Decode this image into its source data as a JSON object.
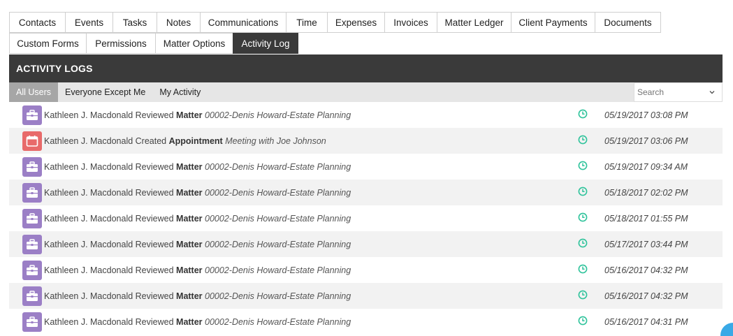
{
  "tabs_row1": [
    {
      "label": "Contacts",
      "name": "tab-contacts"
    },
    {
      "label": "Events",
      "name": "tab-events"
    },
    {
      "label": "Tasks",
      "name": "tab-tasks"
    },
    {
      "label": "Notes",
      "name": "tab-notes"
    },
    {
      "label": "Communications",
      "name": "tab-communications"
    },
    {
      "label": "Time",
      "name": "tab-time"
    },
    {
      "label": "Expenses",
      "name": "tab-expenses"
    },
    {
      "label": "Invoices",
      "name": "tab-invoices"
    },
    {
      "label": "Matter Ledger",
      "name": "tab-matter-ledger"
    },
    {
      "label": "Client Payments",
      "name": "tab-client-payments"
    },
    {
      "label": "Documents",
      "name": "tab-documents"
    }
  ],
  "tabs_row2": [
    {
      "label": "Custom Forms",
      "name": "tab-custom-forms"
    },
    {
      "label": "Permissions",
      "name": "tab-permissions"
    },
    {
      "label": "Matter Options",
      "name": "tab-matter-options"
    },
    {
      "label": "Activity Log",
      "name": "tab-activity-log",
      "active": true
    }
  ],
  "panel": {
    "title": "ACTIVITY LOGS"
  },
  "filters": [
    {
      "label": "All Users",
      "active": true
    },
    {
      "label": "Everyone Except Me"
    },
    {
      "label": "My Activity"
    }
  ],
  "search": {
    "placeholder": "Search"
  },
  "colors": {
    "header": "#3a3a3a",
    "matter_icon": "#9b7fc6",
    "appointment_icon": "#e86a6a",
    "clock": "#2fc39b"
  },
  "logs": [
    {
      "user": "Kathleen J. Macdonald",
      "action": "Reviewed",
      "type": "Matter",
      "detail": "00002-Denis Howard-Estate Planning",
      "time": "05/19/2017 03:08 PM",
      "icon": "briefcase-icon"
    },
    {
      "user": "Kathleen J. Macdonald",
      "action": "Created",
      "type": "Appointment",
      "detail": "Meeting with Joe Johnson",
      "time": "05/19/2017 03:06 PM",
      "icon": "calendar-icon"
    },
    {
      "user": "Kathleen J. Macdonald",
      "action": "Reviewed",
      "type": "Matter",
      "detail": "00002-Denis Howard-Estate Planning",
      "time": "05/19/2017 09:34 AM",
      "icon": "briefcase-icon"
    },
    {
      "user": "Kathleen J. Macdonald",
      "action": "Reviewed",
      "type": "Matter",
      "detail": "00002-Denis Howard-Estate Planning",
      "time": "05/18/2017 02:02 PM",
      "icon": "briefcase-icon"
    },
    {
      "user": "Kathleen J. Macdonald",
      "action": "Reviewed",
      "type": "Matter",
      "detail": "00002-Denis Howard-Estate Planning",
      "time": "05/18/2017 01:55 PM",
      "icon": "briefcase-icon"
    },
    {
      "user": "Kathleen J. Macdonald",
      "action": "Reviewed",
      "type": "Matter",
      "detail": "00002-Denis Howard-Estate Planning",
      "time": "05/17/2017 03:44 PM",
      "icon": "briefcase-icon"
    },
    {
      "user": "Kathleen J. Macdonald",
      "action": "Reviewed",
      "type": "Matter",
      "detail": "00002-Denis Howard-Estate Planning",
      "time": "05/16/2017 04:32 PM",
      "icon": "briefcase-icon"
    },
    {
      "user": "Kathleen J. Macdonald",
      "action": "Reviewed",
      "type": "Matter",
      "detail": "00002-Denis Howard-Estate Planning",
      "time": "05/16/2017 04:32 PM",
      "icon": "briefcase-icon"
    },
    {
      "user": "Kathleen J. Macdonald",
      "action": "Reviewed",
      "type": "Matter",
      "detail": "00002-Denis Howard-Estate Planning",
      "time": "05/16/2017 04:31 PM",
      "icon": "briefcase-icon"
    }
  ]
}
